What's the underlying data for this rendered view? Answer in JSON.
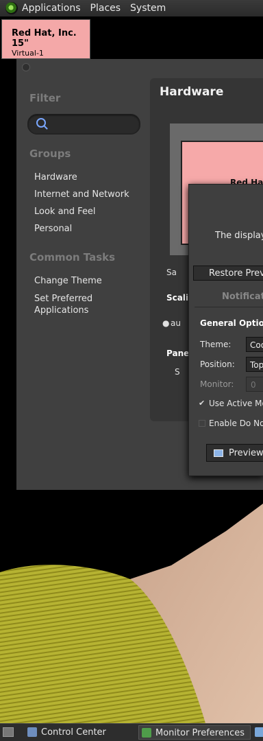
{
  "top_panel": {
    "menus": [
      "Applications",
      "Places",
      "System"
    ]
  },
  "monitor_label": {
    "name": "Red Hat, Inc. 15\"",
    "output": "Virtual-1"
  },
  "control_center": {
    "filter_heading": "Filter",
    "search_placeholder": "",
    "groups_heading": "Groups",
    "groups": [
      "Hardware",
      "Internet and Network",
      "Look and Feel",
      "Personal"
    ],
    "common_tasks_heading": "Common Tasks",
    "tasks": [
      "Change Theme",
      "Set Preferred\nApplications"
    ],
    "content_title": "Hardware",
    "monitor_preview_text": "Red Ha",
    "same_image_label": "Sa",
    "scaling_heading": "Scali",
    "scaling_option": "au",
    "panel_heading": "Pane",
    "panel_option": "S"
  },
  "dialog": {
    "message": "The display",
    "restore_button": "Restore Previo",
    "tab": "Notificatio",
    "general_heading": "General Option",
    "theme_label": "Theme:",
    "theme_value": "Coo",
    "position_label": "Position:",
    "position_value": "Top",
    "monitor_label": "Monitor:",
    "monitor_value": "0",
    "use_active_monitor": "Use Active Mo",
    "enable_do_not_disturb": "Enable Do No",
    "preview_button": "Preview"
  },
  "taskbar": {
    "tasks": [
      "Control Center",
      "Monitor Preferences"
    ]
  },
  "colors": {
    "monitor_pink": "#f4a8a8",
    "panel_dark": "#2d2d2d",
    "window_gray": "#404040",
    "sweater_yellow": "#b7b42f"
  }
}
